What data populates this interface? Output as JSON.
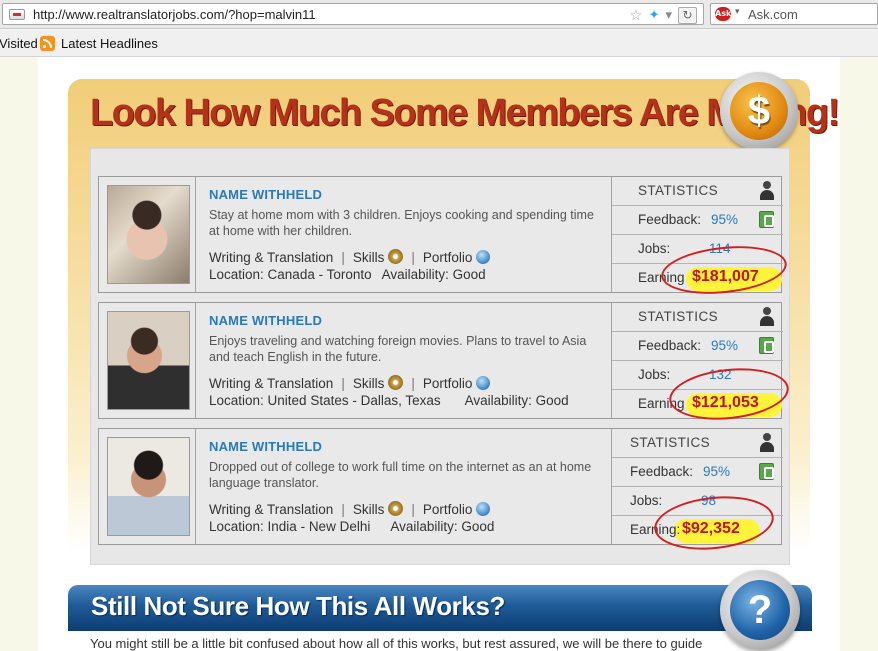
{
  "browser": {
    "url": "http://www.realtranslatorjobs.com/?hop=malvin11",
    "search_engine": "Ask.com",
    "bookmarks": [
      "Visited",
      "Latest Headlines"
    ]
  },
  "earnings_section": {
    "title": "Look How Much Some Members Are Making!",
    "members": [
      {
        "name": "NAME WITHHELD",
        "description": "Stay at home mom with 3 children.  Enjoys cooking and spending time at home with her children.",
        "category": "Writing & Translation",
        "skills_label": "Skills",
        "portfolio_label": "Portfolio",
        "location": "Location:  Canada - Toronto",
        "availability": "Availability:  Good",
        "stats_header": "STATISTICS",
        "feedback_label": "Feedback:",
        "feedback": "95%",
        "jobs_label": "Jobs:",
        "jobs": "114",
        "earnings_label": "Earning",
        "earnings": "$181,007"
      },
      {
        "name": "NAME WITHHELD",
        "description": "Enjoys traveling and watching foreign movies.  Plans to travel to Asia and teach English in the future.",
        "category": "Writing & Translation",
        "skills_label": "Skills",
        "portfolio_label": "Portfolio",
        "location": "Location:  United States - Dallas, Texas",
        "availability": "Availability:  Good",
        "stats_header": "STATISTICS",
        "feedback_label": "Feedback:",
        "feedback": "95%",
        "jobs_label": "Jobs:",
        "jobs": "132",
        "earnings_label": "Earning",
        "earnings": "$121,053"
      },
      {
        "name": "NAME WITHHELD",
        "description": "Dropped out of college to work full time on the internet as an at home language translator.",
        "category": "Writing & Translation",
        "skills_label": "Skills",
        "portfolio_label": "Portfolio",
        "location": "Location:  India - New Delhi",
        "availability": "Availability:  Good",
        "stats_header": "STATISTICS",
        "feedback_label": "Feedback:",
        "feedback": "95%",
        "jobs_label": "Jobs:",
        "jobs": "98",
        "earnings_label": "Earning:",
        "earnings": "$92,352"
      }
    ]
  },
  "how_it_works": {
    "title": "Still Not Sure How This All Works?",
    "text": "You might still be a little bit confused about how all of this works, but rest assured, we will be there to guide"
  },
  "colors": {
    "title_red": "#b3321a",
    "name_blue": "#2a7ab8",
    "earnings_red": "#c0141b",
    "highlight_yellow": "#fff43a",
    "banner_blue": "#1e5a96"
  }
}
